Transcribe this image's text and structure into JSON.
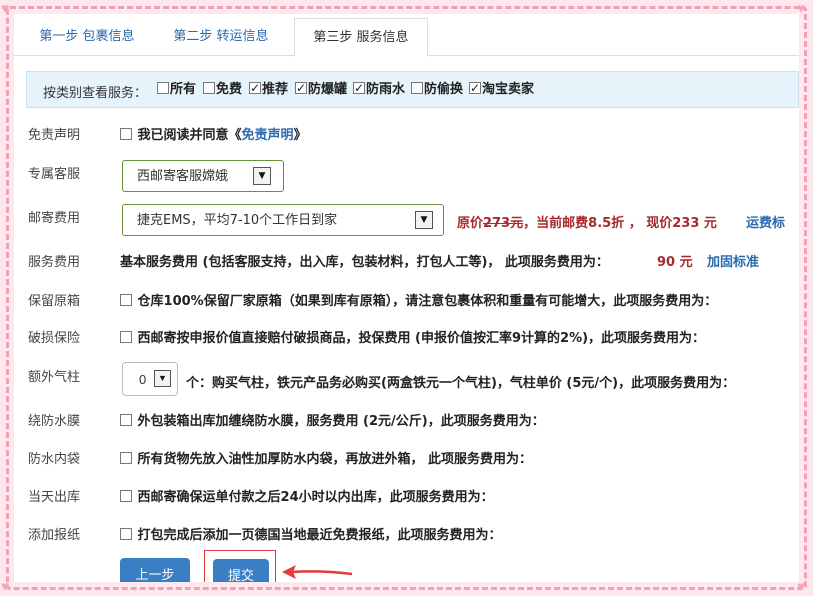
{
  "tabs": [
    {
      "label": "第一步 包裹信息"
    },
    {
      "label": "第二步 转运信息"
    },
    {
      "label": "第三步 服务信息"
    }
  ],
  "filter": {
    "label": "按类别查看服务：",
    "items": [
      {
        "label": "所有",
        "checked": false
      },
      {
        "label": "免费",
        "checked": false
      },
      {
        "label": "推荐",
        "checked": true
      },
      {
        "label": "防爆罐",
        "checked": true
      },
      {
        "label": "防雨水",
        "checked": true
      },
      {
        "label": "防偷换",
        "checked": false
      },
      {
        "label": "淘宝卖家",
        "checked": true
      }
    ]
  },
  "rows": {
    "disclaimer": {
      "label": "免责声明",
      "text": "我已阅读并同意《",
      "link": "免责声明",
      "tail": "》"
    },
    "service_agent": {
      "label": "专属客服",
      "value": "西邮寄客服嫦娥"
    },
    "postage": {
      "label": "邮寄费用",
      "value": "捷克EMS，平均7-10个工作日到家",
      "orig_prefix": "原价",
      "orig_price": "273元",
      "current": "，当前邮费8.5折 ，",
      "now": "现价233 元",
      "link": "运费标"
    },
    "service_fee": {
      "label": "服务费用",
      "text": "基本服务费用 (包括客服支持，出入库，包装材料，打包人工等)， 此项服务费用为：",
      "price": "90 元",
      "link": "加固标准"
    },
    "box_keep": {
      "label": "保留原箱",
      "text": "仓库100%保留厂家原箱（如果到库有原箱），请注意包裹体积和重量有可能增大，此项服务费用为："
    },
    "insurance": {
      "label": "破损保险",
      "text": "西邮寄按申报价值直接赔付破损商品，投保费用 (申报价值按汇率9计算的2%)，此项服务费用为："
    },
    "air_column": {
      "label": "额外气柱",
      "value": "0",
      "text": "个：购买气柱，铁元产品务必购买(两盒铁元一个气柱)，气柱单价 (5元/个)，此项服务费用为："
    },
    "wrap_film": {
      "label": "绕防水膜",
      "text": "外包装箱出库加缠绕防水膜，服务费用 (2元/公斤)，此项服务费用为："
    },
    "inner_bag": {
      "label": "防水内袋",
      "text": "所有货物先放入油性加厚防水内袋，再放进外箱， 此项服务费用为："
    },
    "same_day": {
      "label": "当天出库",
      "text": "西邮寄确保运单付款之后24小时以内出库，此项服务费用为："
    },
    "newspaper": {
      "label": "添加报纸",
      "text": "打包完成后添加一页德国当地最近免费报纸，此项服务费用为："
    }
  },
  "buttons": {
    "prev": "上一步",
    "submit": "提交"
  },
  "colors": {
    "frame": "#fde8ee",
    "dash": "#f2a0b6",
    "accent": "#3a7fc4",
    "price": "#a8292c",
    "link": "#2a6bb0"
  }
}
